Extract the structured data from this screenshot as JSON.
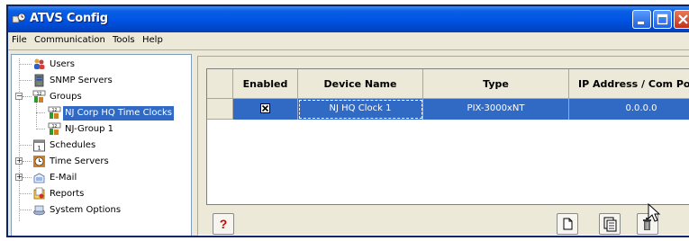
{
  "window": {
    "title": "ATVS Config",
    "controls": {
      "minimize": "_",
      "maximize": "□",
      "close": "X"
    }
  },
  "menu": [
    "File",
    "Communication",
    "Tools",
    "Help"
  ],
  "tree": {
    "users": "Users",
    "snmp": "SNMP Servers",
    "groups": "Groups",
    "group1": "NJ Corp HQ Time Clocks",
    "group2": "NJ-Group 1",
    "schedules": "Schedules",
    "time_servers": "Time Servers",
    "email": "E-Mail",
    "reports": "Reports",
    "system_options": "System Options"
  },
  "grid": {
    "columns": [
      "Enabled",
      "Device Name",
      "Type",
      "IP Address / Com Port"
    ],
    "rows": [
      {
        "enabled": "☒",
        "device_name": "NJ HQ Clock 1",
        "type": "PIX-3000xNT",
        "ip": "0.0.0.0"
      }
    ]
  },
  "toolbar": {
    "help": "?",
    "icons": [
      "new-document-icon",
      "copy-document-icon",
      "trash-icon"
    ]
  },
  "colors": {
    "titlebar": "#0055e5",
    "selection": "#316ac5",
    "window_bg": "#ece9d8"
  }
}
